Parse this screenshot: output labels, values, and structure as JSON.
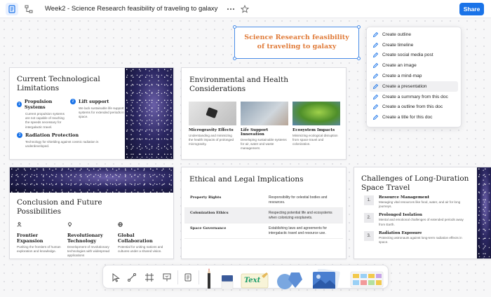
{
  "header": {
    "title": "Week2 -  Science Research feasibility of traveling to galaxy",
    "share_label": "Share"
  },
  "selected_text": "Science Research feasibility of traveling to galaxy",
  "ai_menu": {
    "items": [
      "Create outline",
      "Create timeline",
      "Create social media post",
      "Create an image",
      "Create a mind-map",
      "Create a presentation",
      "Create a summary from this doc",
      "Create a outline from this doc",
      "Create a title for this doc"
    ]
  },
  "slide1": {
    "title": "Current Technological Limitations",
    "points": [
      {
        "num": "1",
        "title": "Propulsion Systems",
        "desc": "Current propulsion systems are not capable of reaching the speeds necessary for intergalactic travel."
      },
      {
        "num": "2",
        "title": "Lift support",
        "desc": "We lack sustainable life support systems for extended periods in space."
      },
      {
        "num": "3",
        "title": "Radiation Protection",
        "desc": "Technology for shielding against cosmic radiation is underdeveloped."
      }
    ]
  },
  "slide2": {
    "title": "Environmental and Health Considerations",
    "cards": [
      {
        "title": "Microgravity Effects",
        "desc": "Understanding and minimizing the health impacts of prolonged microgravity."
      },
      {
        "title": "Life Support Innovation",
        "desc": "Developing sustainable systems for air, water and waste management."
      },
      {
        "title": "Ecosystem Impacts",
        "desc": "Minimizing ecological disruption from space travel and colonization."
      }
    ]
  },
  "slide3": {
    "title": "Conclusion and Future Possibilities",
    "items": [
      {
        "title": "Frontier Expansion",
        "desc": "Pushing the frontiers of human exploration and knowledge."
      },
      {
        "title": "Revolutionary Technology",
        "desc": "Development of revolutionary technologies with widespread applications"
      },
      {
        "title": "Global Collaboration",
        "desc": "Potential for uniting nations and cultures under a shared vision."
      }
    ]
  },
  "slide4": {
    "title": "Ethical and Legal Implications",
    "rows": [
      {
        "label": "Property Rights",
        "value": "Responsibility for celestial bodies and resources."
      },
      {
        "label": "Colonization Ethics",
        "value": "Respecting potential life and ecosystems when colonizing exoplanets."
      },
      {
        "label": "Space Governance",
        "value": "Establishing laws and agreements for intergalactic travel and resource use."
      }
    ]
  },
  "slide5": {
    "title": "Challenges of Long-Duration Space Travel",
    "items": [
      {
        "num": "1.",
        "title": "Resource Management",
        "desc": "Managing vital resources like food, water, and air for long journeys."
      },
      {
        "num": "2.",
        "title": "Prolonged Isolation",
        "desc": "Mental and emotional challenges of extended periods away from Earth."
      },
      {
        "num": "3.",
        "title": "Radiation Exposure",
        "desc": "Protecting astronauts against long-term radiation effects in space."
      }
    ]
  },
  "toolbar": {
    "text_sticker_label": "Text"
  }
}
